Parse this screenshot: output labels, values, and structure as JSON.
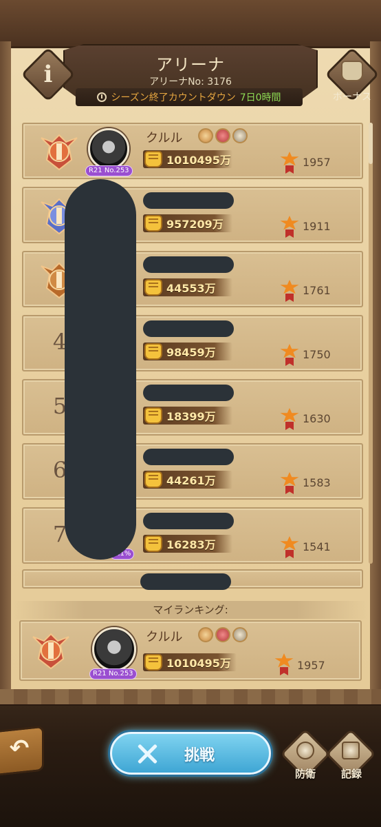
{
  "header": {
    "title": "アリーナ",
    "arena_no": "アリーナNo: 3176",
    "countdown_label": "シーズン終了カウントダウン",
    "countdown_value": "7日0時間",
    "info_glyph": "i",
    "bonus_label": "ボーナス"
  },
  "rankings": [
    {
      "rank": "",
      "name": "クルル",
      "power": "1010495万",
      "score": "1957",
      "level": "R21 No.253"
    },
    {
      "rank": "",
      "name": "",
      "power": "957209万",
      "score": "1911",
      "level": ""
    },
    {
      "rank": "",
      "name": "",
      "power": "44553万",
      "score": "1761",
      "level": ""
    },
    {
      "rank": "4",
      "name": "",
      "power": "98459万",
      "score": "1750",
      "level": ""
    },
    {
      "rank": "5",
      "name": "",
      "power": "18399万",
      "score": "1630",
      "level": ""
    },
    {
      "rank": "6",
      "name": "",
      "power": "44261万",
      "score": "1583",
      "level": ""
    },
    {
      "rank": "7",
      "name": "",
      "power": "16283万",
      "score": "1541",
      "level": "5.1%"
    }
  ],
  "my_ranking": {
    "label": "マイランキング:",
    "name": "クルル",
    "power": "1010495万",
    "score": "1957",
    "level": "R21 No.253"
  },
  "bottom": {
    "back_glyph": "↶",
    "challenge_label": "挑戦",
    "defense_label": "防衛",
    "record_label": "記録"
  },
  "colors": {
    "challenge_button": "#3fa6d4",
    "power_value": "#ffe8a8",
    "countdown_value": "#8edb54",
    "countdown_label": "#e6a640",
    "medal": "#f08a20"
  }
}
